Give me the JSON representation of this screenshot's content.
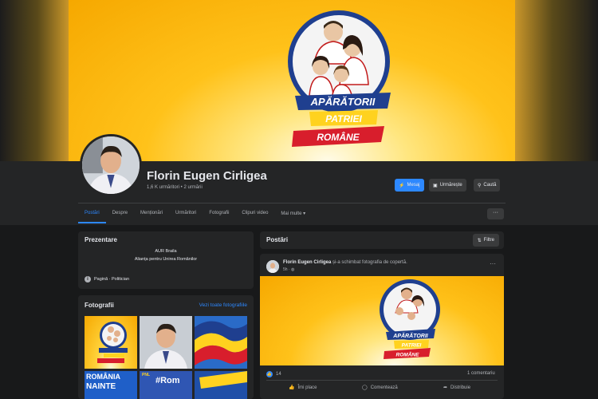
{
  "profile": {
    "name": "Florin Eugen Cirligea",
    "followers": "1,6 K urmăritori • 2 urmării"
  },
  "cover": {
    "banner_line1": "APĂRĂTORII",
    "banner_line2": "PATRIEI",
    "banner_line3": "ROMÂNE"
  },
  "actions": {
    "message": "Mesaj",
    "follow": "Urmărește",
    "search": "Caută"
  },
  "tabs": [
    {
      "label": "Postări",
      "active": true
    },
    {
      "label": "Despre"
    },
    {
      "label": "Menționări"
    },
    {
      "label": "Urmăritori"
    },
    {
      "label": "Fotografii"
    },
    {
      "label": "Clipuri video"
    },
    {
      "label": "Mai multe ▾"
    }
  ],
  "tabs_more": "···",
  "intro": {
    "title": "Prezentare",
    "line1": "AUR Braila",
    "line2": "Alianța pentru Unirea Românilor",
    "page_type": "Pagină · Politician"
  },
  "photos": {
    "title": "Fotografii",
    "see_all": "Vezi toate fotografiile",
    "tile5_text_a": "ROMÂNIA",
    "tile5_text_b": "NAINTE",
    "tile6_text": "#Rom",
    "tile6_sub": "PNL"
  },
  "posts": {
    "title": "Postări",
    "filter": "Filtre",
    "author": "Florin Eugen Cirligea",
    "action_text": "și-a schimbat fotografia de copertă.",
    "time": "5h · ",
    "more": "···",
    "reactions": "14",
    "comments": "1 comentariu",
    "like": "Îmi place",
    "comment": "Comentează",
    "share": "Distribuie"
  },
  "colors": {
    "accent": "#2d88ff",
    "background": "#18191a",
    "card": "#242526",
    "cover_yellow": "#ffc21a"
  }
}
